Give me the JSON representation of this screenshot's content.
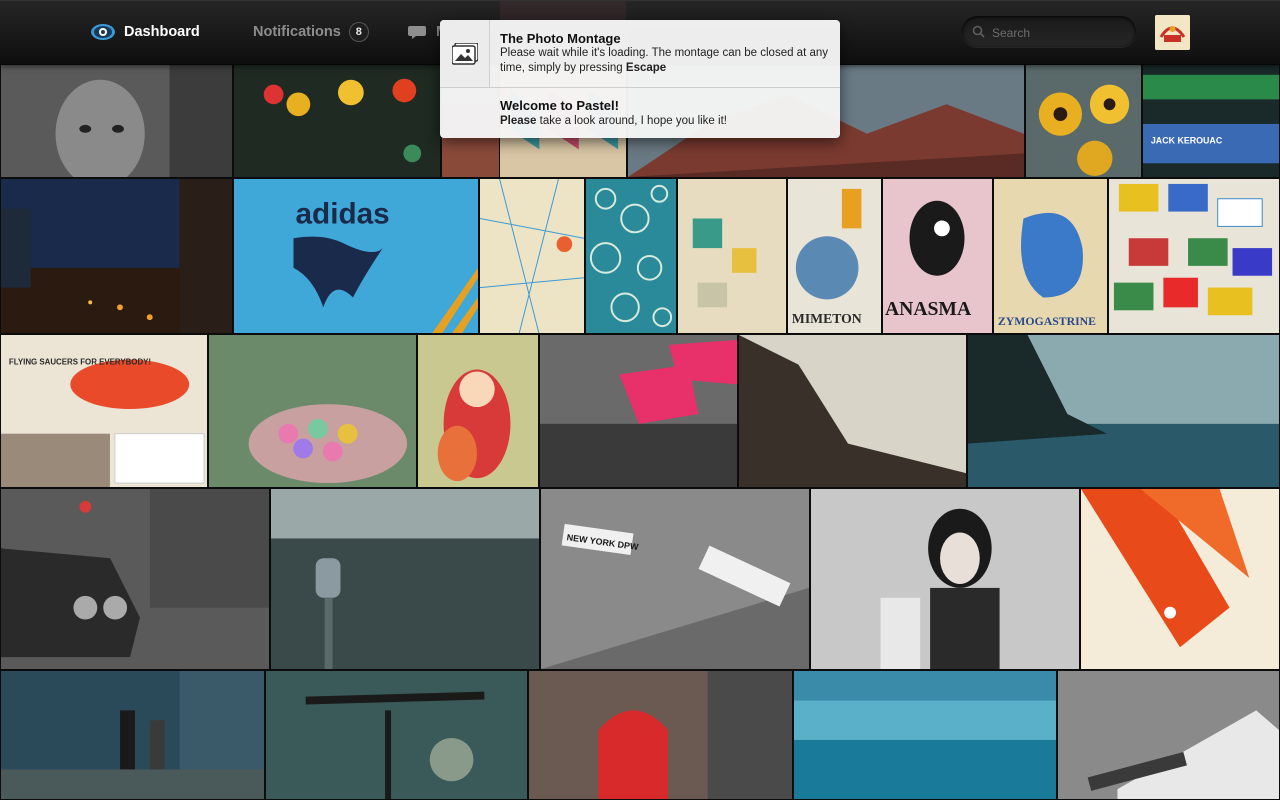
{
  "nav": {
    "dashboard_label": "Dashboard",
    "notifications_label": "Notifications",
    "notifications_count": "8",
    "messages_label": "M"
  },
  "search": {
    "placeholder": "Search",
    "value": ""
  },
  "notifications": [
    {
      "title": "The Photo Montage",
      "text_before": "Please wait while it's loading. The montage can be closed at any time, simply by pressing ",
      "text_key": "Escape",
      "icon": "photos-icon"
    },
    {
      "title": "Welcome to Pastel!",
      "text_bold": "Please",
      "text_after": " take a look around, I hope you like it!"
    }
  ],
  "photos": {
    "adidas_poster": "adidas",
    "mimeton_poster": "MIMETON",
    "anasma_poster": "ANASMA",
    "zymogastrine_poster": "ZYMOGASTRINE",
    "flying_saucers_text": "FLYING SAUCERS FOR EVERYBODY!",
    "new_york_sign": "NEW YORK DPW",
    "jack_kerouac_book": "JACK KEROUAC"
  },
  "colors": {
    "accent": "#3a9ad9",
    "badge_bg": "#1e1e1e",
    "panel_bg": "#f5f5f5"
  }
}
